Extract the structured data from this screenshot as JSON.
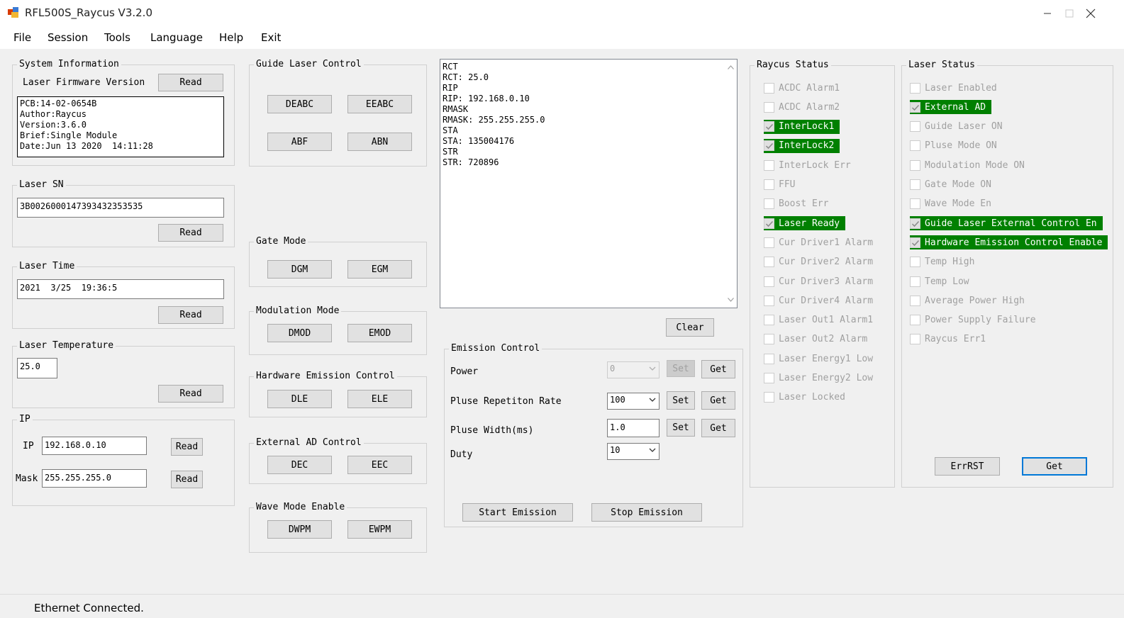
{
  "window": {
    "title": "RFL500S_Raycus V3.2.0"
  },
  "menu": [
    "File",
    "Session",
    "Tools",
    "Language",
    "Help",
    "Exit"
  ],
  "system_info": {
    "title": "System Information",
    "firmware_label": "Laser Firmware Version",
    "read_label": "Read",
    "info_text": "PCB:14-02-0654B\nAuthor:Raycus\nVersion:3.6.0\nBrief:Single Module\nDate:Jun 13 2020  14:11:28"
  },
  "laser_sn": {
    "title": "Laser SN",
    "value": "3B0026000147393432353535",
    "read_label": "Read"
  },
  "laser_time": {
    "title": "Laser Time",
    "value": "2021  3/25  19:36:5",
    "read_label": "Read"
  },
  "laser_temperature": {
    "title": "Laser Temperature",
    "value": "25.0",
    "read_label": "Read"
  },
  "ip": {
    "title": "IP",
    "ip_label": "IP",
    "ip_value": "192.168.0.10",
    "mask_label": "Mask",
    "mask_value": "255.255.255.0",
    "read_label": "Read"
  },
  "guide_laser": {
    "title": "Guide Laser Control",
    "buttons": [
      "DEABC",
      "EEABC",
      "ABF",
      "ABN"
    ]
  },
  "gate_mode": {
    "title": "Gate Mode",
    "buttons": [
      "DGM",
      "EGM"
    ]
  },
  "modulation_mode": {
    "title": "Modulation Mode",
    "buttons": [
      "DMOD",
      "EMOD"
    ]
  },
  "hardware_emission": {
    "title": "Hardware Emission Control",
    "buttons": [
      "DLE",
      "ELE"
    ]
  },
  "external_ad": {
    "title": "External AD Control",
    "buttons": [
      "DEC",
      "EEC"
    ]
  },
  "wave_mode": {
    "title": "Wave Mode Enable",
    "buttons": [
      "DWPM",
      "EWPM"
    ]
  },
  "log": {
    "text": "RCT\nRCT: 25.0\nRIP\nRIP: 192.168.0.10\nRMASK\nRMASK: 255.255.255.0\nSTA\nSTA: 135004176\nSTR\nSTR: 720896",
    "clear_label": "Clear"
  },
  "emission": {
    "title": "Emission Control",
    "power_label": "Power",
    "power_value": "0",
    "rate_label": "Pluse Repetiton Rate",
    "rate_value": "100",
    "width_label": "Pluse Width(ms)",
    "width_value": "1.0",
    "duty_label": "Duty",
    "duty_value": "10",
    "set_label": "Set",
    "get_label": "Get",
    "start_label": "Start Emission",
    "stop_label": "Stop Emission"
  },
  "raycus_status": {
    "title": "Raycus Status",
    "items": [
      {
        "label": "ACDC Alarm1",
        "checked": false
      },
      {
        "label": "ACDC Alarm2",
        "checked": false
      },
      {
        "label": "InterLock1",
        "checked": true
      },
      {
        "label": "InterLock2",
        "checked": true
      },
      {
        "label": "InterLock Err",
        "checked": false
      },
      {
        "label": "FFU",
        "checked": false
      },
      {
        "label": "Boost Err",
        "checked": false
      },
      {
        "label": "Laser Ready",
        "checked": true
      },
      {
        "label": "Cur Driver1 Alarm",
        "checked": false
      },
      {
        "label": "Cur Driver2 Alarm",
        "checked": false
      },
      {
        "label": "Cur Driver3 Alarm",
        "checked": false
      },
      {
        "label": "Cur Driver4 Alarm",
        "checked": false
      },
      {
        "label": "Laser Out1 Alarm1",
        "checked": false
      },
      {
        "label": "Laser Out2 Alarm",
        "checked": false
      },
      {
        "label": "Laser Energy1 Low",
        "checked": false
      },
      {
        "label": "Laser Energy2 Low",
        "checked": false
      },
      {
        "label": "Laser Locked",
        "checked": false
      }
    ]
  },
  "laser_status": {
    "title": "Laser Status",
    "items": [
      {
        "label": "Laser Enabled",
        "checked": false
      },
      {
        "label": "External AD",
        "checked": true
      },
      {
        "label": "Guide Laser ON",
        "checked": false
      },
      {
        "label": "Pluse Mode ON",
        "checked": false
      },
      {
        "label": "Modulation Mode ON",
        "checked": false
      },
      {
        "label": "Gate Mode ON",
        "checked": false
      },
      {
        "label": "Wave Mode En",
        "checked": false
      },
      {
        "label": "Guide Laser External Control En",
        "checked": true
      },
      {
        "label": "Hardware Emission Control Enable",
        "checked": true
      },
      {
        "label": "Temp High",
        "checked": false
      },
      {
        "label": "Temp Low",
        "checked": false
      },
      {
        "label": "Average Power High",
        "checked": false
      },
      {
        "label": "Power Supply Failure",
        "checked": false
      },
      {
        "label": "Raycus Err1",
        "checked": false
      }
    ],
    "errrst_label": "ErrRST",
    "get_label": "Get"
  },
  "status_bar": {
    "text": "Ethernet  Connected."
  },
  "colors": {
    "checked_bg": "#008000",
    "focus_border": "#0078d7"
  }
}
